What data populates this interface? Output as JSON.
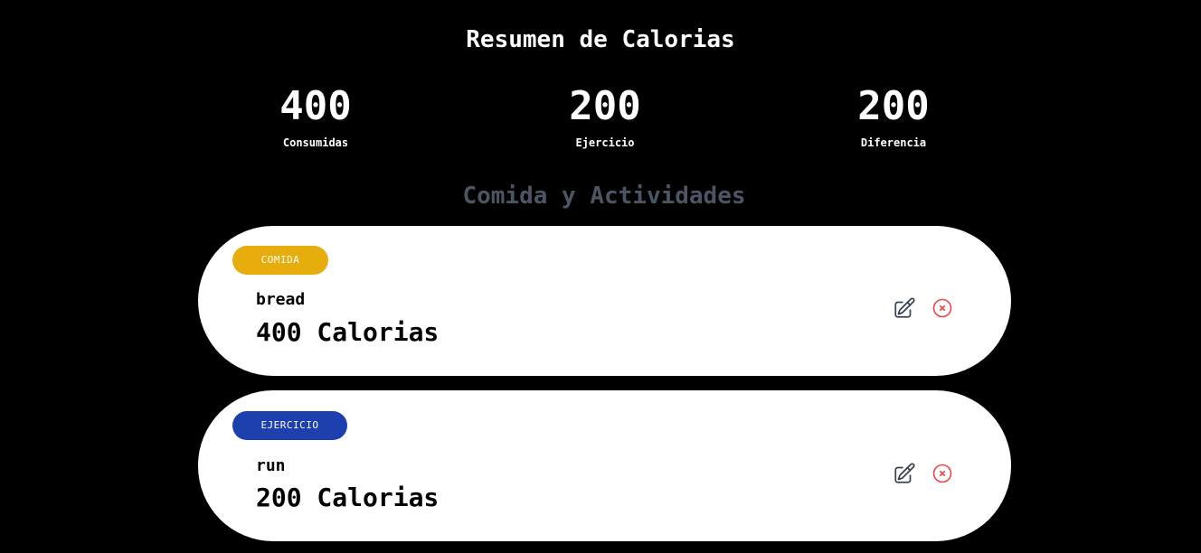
{
  "summary": {
    "title": "Resumen de Calorias",
    "consumed": {
      "value": "400",
      "label": "Consumidas"
    },
    "exercise": {
      "value": "200",
      "label": "Ejercicio"
    },
    "difference": {
      "value": "200",
      "label": "Diferencia"
    }
  },
  "activities": {
    "title": "Comida y Actividades",
    "items": [
      {
        "category": "COMIDA",
        "name": "bread",
        "calories": "400 Calorias",
        "badge_color": "#e6ad0c",
        "edit_icon": "pencil-square-icon",
        "delete_icon": "x-circle-icon"
      },
      {
        "category": "EJERCICIO",
        "name": "run",
        "calories": "200 Calorias",
        "badge_color": "#1e40af",
        "edit_icon": "pencil-square-icon",
        "delete_icon": "x-circle-icon"
      }
    ]
  },
  "colors": {
    "background": "#000000",
    "section_title": "#4b5563",
    "card": "#ffffff",
    "delete_icon": "#ef4444",
    "edit_icon": "#374151"
  }
}
